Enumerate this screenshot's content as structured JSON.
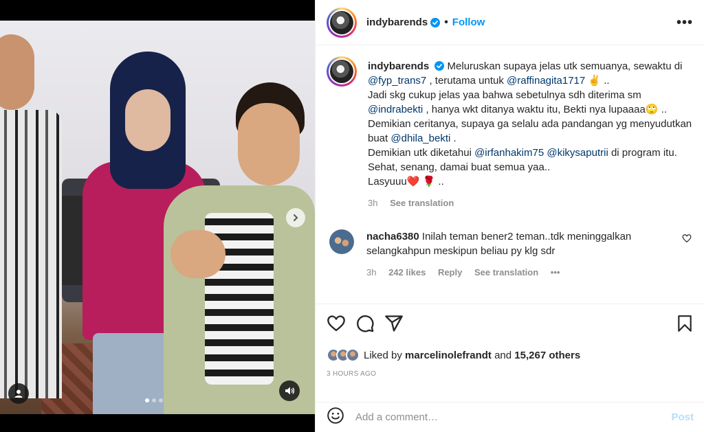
{
  "post": {
    "username": "indybarends",
    "separator": "•",
    "follow_label": "Follow",
    "more_icon": "more-horizontal-icon",
    "accent_color": "#0095f6"
  },
  "media": {
    "slide_count": 3,
    "active_slide": 1,
    "next_icon": "chevron-right-icon",
    "audio_icon": "speaker-icon",
    "tag_icon": "user-tag-icon"
  },
  "caption": {
    "username": "indybarends",
    "segments": [
      {
        "t": "Meluruskan supaya jelas utk semuanya, sewaktu di ",
        "m": false
      },
      {
        "t": "@fyp_trans7",
        "m": true
      },
      {
        "t": " , terutama untuk ",
        "m": false
      },
      {
        "t": "@raffinagita1717",
        "m": true
      },
      {
        "t": " ✌️ ..",
        "m": false
      },
      {
        "t": "\nJadi skg cukup jelas yaa bahwa sebetulnya sdh diterima sm ",
        "m": false
      },
      {
        "t": "@indrabekti",
        "m": true
      },
      {
        "t": " , hanya wkt ditanya waktu itu, Bekti nya lupaaaa🙄 ..",
        "m": false
      },
      {
        "t": "\nDemikian ceritanya, supaya ga selalu ada pandangan yg menyudutkan buat ",
        "m": false
      },
      {
        "t": "@dhila_bekti",
        "m": true
      },
      {
        "t": " .",
        "m": false
      },
      {
        "t": "\nDemikian utk diketahui ",
        "m": false
      },
      {
        "t": "@irfanhakim75",
        "m": true
      },
      {
        "t": " ",
        "m": false
      },
      {
        "t": "@kikysaputrii",
        "m": true
      },
      {
        "t": " di program itu.",
        "m": false
      },
      {
        "t": "\nSehat, senang, damai buat semua yaa..",
        "m": false
      },
      {
        "t": "\nLasyuuu❤️ 🌹 ..",
        "m": false
      }
    ],
    "time": "3h",
    "see_translation": "See translation"
  },
  "comment": {
    "username": "nacha6380",
    "text": "Inilah teman bener2 teman..tdk meninggalkan selangkahpun meskipun beliau py klg sdr",
    "time": "3h",
    "likes": "242 likes",
    "reply": "Reply",
    "see_translation": "See translation",
    "more": "•••"
  },
  "actions": {
    "like_icon": "heart-icon",
    "comment_icon": "comment-icon",
    "share_icon": "send-icon",
    "save_icon": "bookmark-icon"
  },
  "likes": {
    "prefix": "Liked by",
    "user": "marcelinolefrandt",
    "and": "and",
    "others": "15,267 others"
  },
  "timestamp": "3 HOURS AGO",
  "add_comment": {
    "emoji_icon": "emoji-icon",
    "placeholder": "Add a comment…",
    "post_label": "Post"
  }
}
